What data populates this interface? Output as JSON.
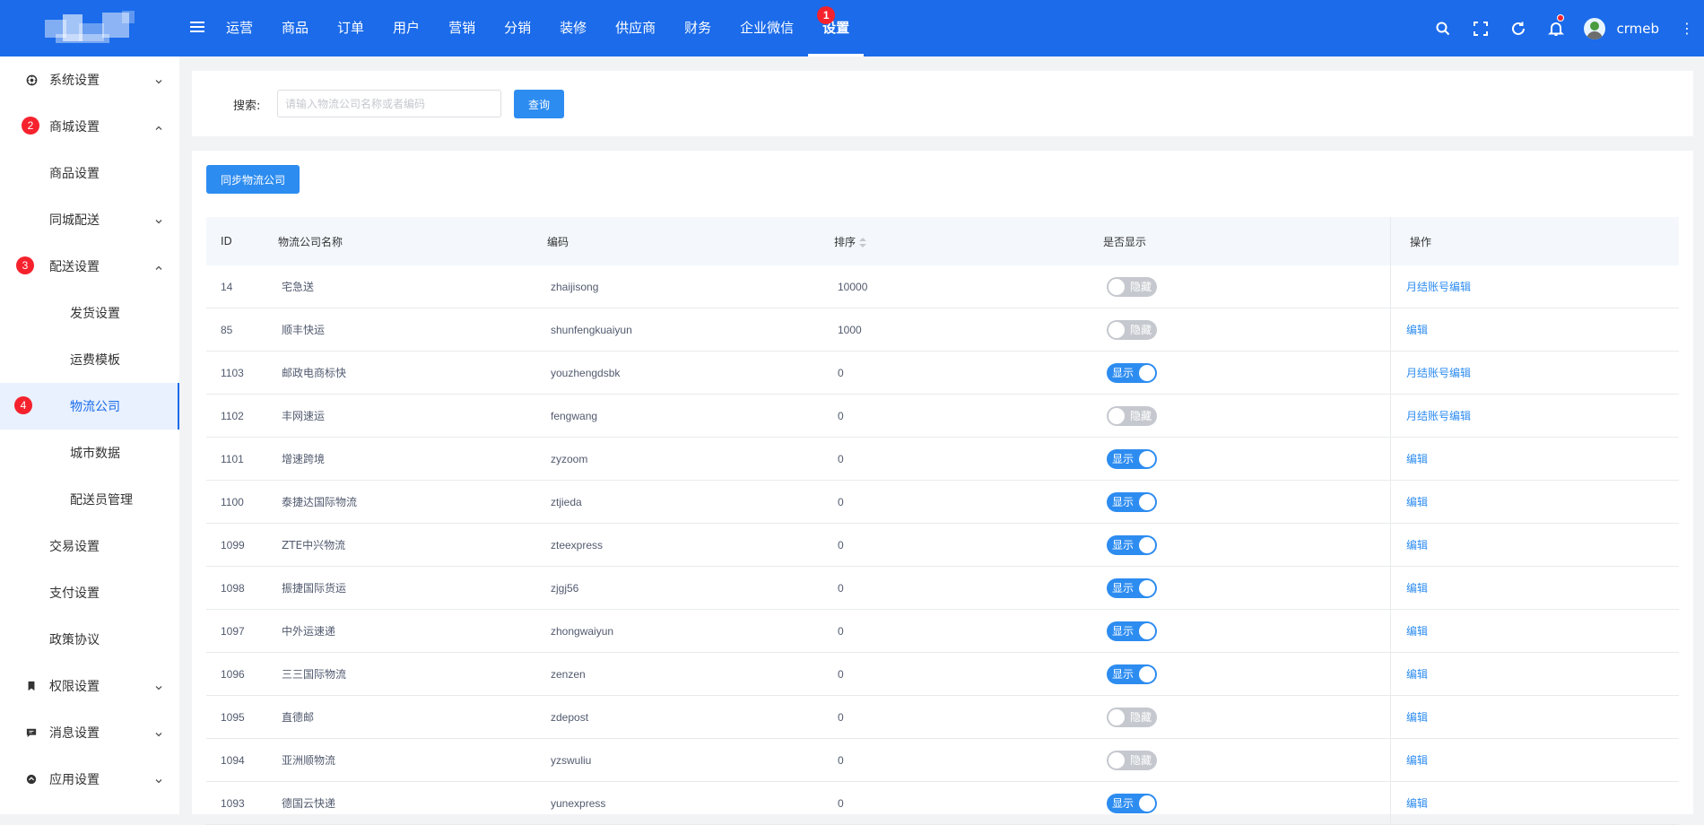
{
  "topbar": {
    "nav": [
      {
        "label": "运营"
      },
      {
        "label": "商品"
      },
      {
        "label": "订单"
      },
      {
        "label": "用户"
      },
      {
        "label": "营销"
      },
      {
        "label": "分销"
      },
      {
        "label": "装修"
      },
      {
        "label": "供应商"
      },
      {
        "label": "财务"
      },
      {
        "label": "企业微信"
      },
      {
        "label": "设置",
        "active": true,
        "step": "1"
      }
    ],
    "username": "crmeb"
  },
  "sidebar": {
    "items": [
      {
        "label": "系统设置",
        "icon": "gear-icon",
        "chevron": "down"
      },
      {
        "label": "商城设置",
        "step": "2",
        "chevron": "up"
      },
      {
        "label": "商品设置"
      },
      {
        "label": "同城配送",
        "chevron": "down"
      },
      {
        "label": "配送设置",
        "step": "3",
        "chevron": "up"
      },
      {
        "label": "发货设置"
      },
      {
        "label": "运费模板"
      },
      {
        "label": "物流公司",
        "step": "4",
        "active": true
      },
      {
        "label": "城市数据"
      },
      {
        "label": "配送员管理"
      },
      {
        "label": "交易设置"
      },
      {
        "label": "支付设置"
      },
      {
        "label": "政策协议"
      },
      {
        "label": "权限设置",
        "icon": "bookmark-icon",
        "chevron": "down"
      },
      {
        "label": "消息设置",
        "icon": "message-icon",
        "chevron": "down"
      },
      {
        "label": "应用设置",
        "icon": "app-icon",
        "chevron": "down"
      }
    ]
  },
  "search": {
    "label": "搜索:",
    "placeholder": "请输入物流公司名称或者编码",
    "button": "查询"
  },
  "toolbar": {
    "sync_button": "同步物流公司"
  },
  "table": {
    "headers": {
      "id": "ID",
      "name": "物流公司名称",
      "code": "编码",
      "sort": "排序",
      "show": "是否显示",
      "op": "操作"
    },
    "switch_labels": {
      "on": "显示",
      "off": "隐藏"
    },
    "rows": [
      {
        "id": "14",
        "name": "宅急送",
        "code": "zhaijisong",
        "sort": "10000",
        "show": false,
        "op": "月结账号编辑"
      },
      {
        "id": "85",
        "name": "顺丰快运",
        "code": "shunfengkuaiyun",
        "sort": "1000",
        "show": false,
        "op": "编辑"
      },
      {
        "id": "1103",
        "name": "邮政电商标快",
        "code": "youzhengdsbk",
        "sort": "0",
        "show": true,
        "op": "月结账号编辑"
      },
      {
        "id": "1102",
        "name": "丰网速运",
        "code": "fengwang",
        "sort": "0",
        "show": false,
        "op": "月结账号编辑"
      },
      {
        "id": "1101",
        "name": "增速跨境",
        "code": "zyzoom",
        "sort": "0",
        "show": true,
        "op": "编辑"
      },
      {
        "id": "1100",
        "name": "泰捷达国际物流",
        "code": "ztjieda",
        "sort": "0",
        "show": true,
        "op": "编辑"
      },
      {
        "id": "1099",
        "name": "ZTE中兴物流",
        "code": "zteexpress",
        "sort": "0",
        "show": true,
        "op": "编辑"
      },
      {
        "id": "1098",
        "name": "振捷国际货运",
        "code": "zjgj56",
        "sort": "0",
        "show": true,
        "op": "编辑"
      },
      {
        "id": "1097",
        "name": "中外运速递",
        "code": "zhongwaiyun",
        "sort": "0",
        "show": true,
        "op": "编辑"
      },
      {
        "id": "1096",
        "name": "三三国际物流",
        "code": "zenzen",
        "sort": "0",
        "show": true,
        "op": "编辑"
      },
      {
        "id": "1095",
        "name": "直德邮",
        "code": "zdepost",
        "sort": "0",
        "show": false,
        "op": "编辑"
      },
      {
        "id": "1094",
        "name": "亚洲顺物流",
        "code": "yzswuliu",
        "sort": "0",
        "show": false,
        "op": "编辑"
      },
      {
        "id": "1093",
        "name": "德国云快递",
        "code": "yunexpress",
        "sort": "0",
        "show": true,
        "op": "编辑"
      }
    ]
  },
  "colors": {
    "brand": "#1b6bea",
    "primary": "#2d8cf0",
    "step_badge": "#f5222d"
  }
}
